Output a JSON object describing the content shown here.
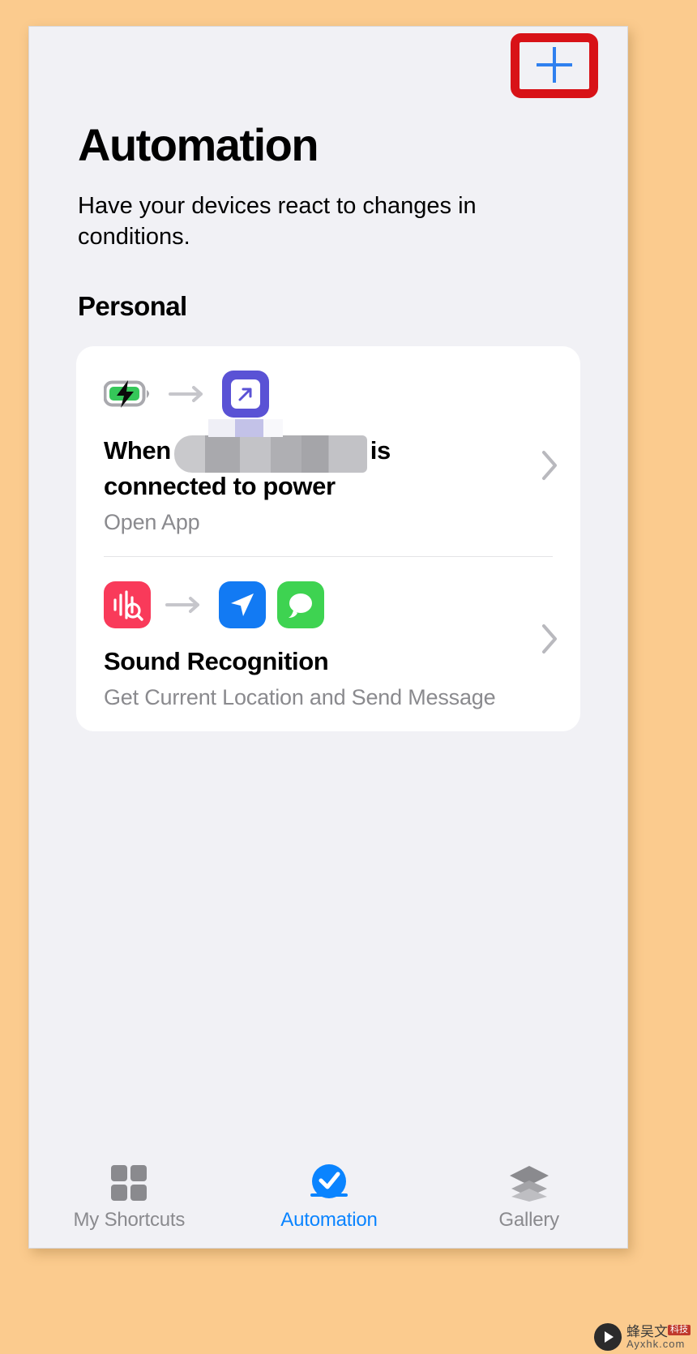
{
  "nav": {
    "add_button_icon": "plus-icon",
    "add_button_label": "+"
  },
  "header": {
    "title": "Automation",
    "subtitle": "Have your devices react to changes in conditions.",
    "section_title": "Personal"
  },
  "automations": [
    {
      "trigger_icon": "battery-charging-icon",
      "arrow_icon": "arrow-right-icon",
      "action_icons": [
        "open-app-icon"
      ],
      "title_prefix": "When",
      "title_redacted": "[redacted app name]",
      "title_suffix": "is connected to power",
      "subtitle": "Open App",
      "chevron_icon": "chevron-right-icon"
    },
    {
      "trigger_icon": "sound-recognition-icon",
      "arrow_icon": "arrow-right-icon",
      "action_icons": [
        "location-icon",
        "messages-icon"
      ],
      "title": "Sound Recognition",
      "subtitle": "Get Current Location and Send Message",
      "chevron_icon": "chevron-right-icon"
    }
  ],
  "tabs": [
    {
      "label": "My Shortcuts",
      "icon": "grid-icon",
      "active": false
    },
    {
      "label": "Automation",
      "icon": "automation-check-icon",
      "active": true
    },
    {
      "label": "Gallery",
      "icon": "layers-icon",
      "active": false
    }
  ],
  "watermark": {
    "line1": "蜂吴文",
    "badge": "科技",
    "line2": "Ayxhk.com"
  },
  "colors": {
    "accent_blue": "#0A84FF",
    "plus_blue": "#2F80EF",
    "highlight_red": "#D81217",
    "screen_bg": "#F1F1F5",
    "card_bg": "#FFFFFF",
    "page_bg": "#FBCB8E",
    "open_app_purple": "#5A52D5",
    "sound_red": "#F93A5A",
    "location_blue": "#127AF3",
    "messages_green": "#3ED351",
    "subtitle_gray": "#8A8A8E"
  }
}
